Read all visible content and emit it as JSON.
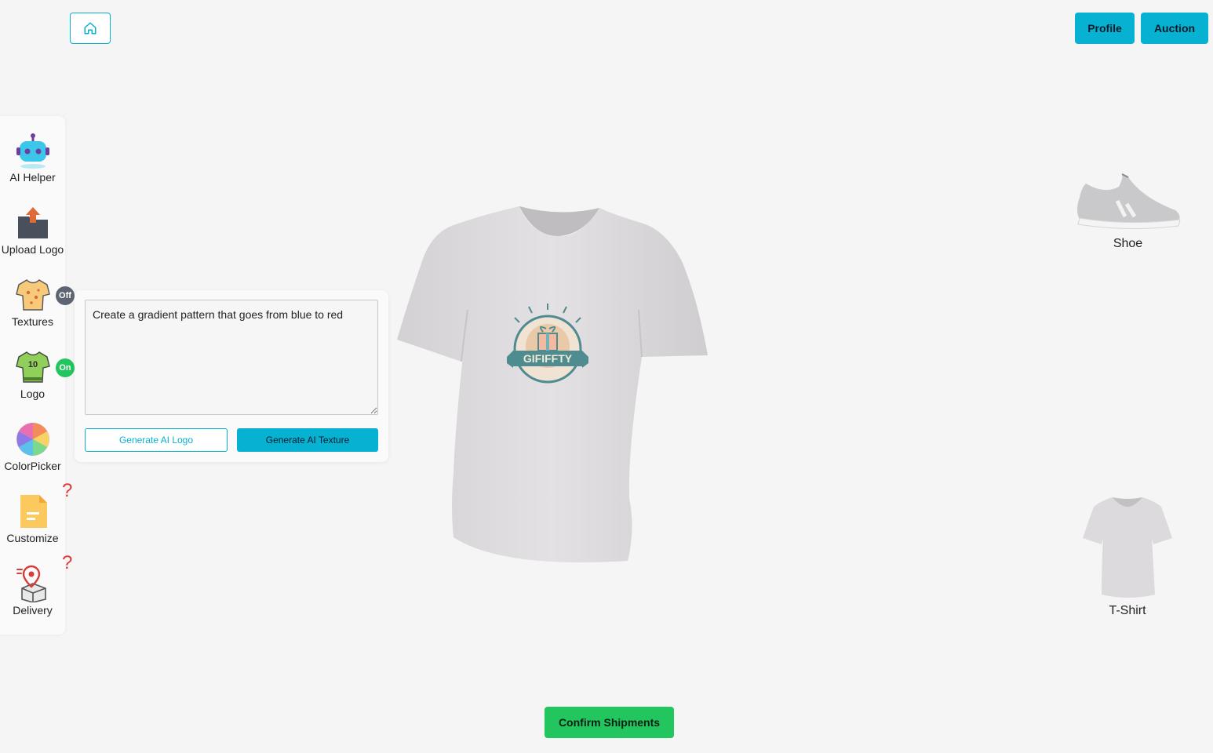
{
  "header": {
    "home_icon": "home-icon",
    "profile_label": "Profile",
    "auction_label": "Auction"
  },
  "sidebar": {
    "items": [
      {
        "label": "AI Helper",
        "icon": "robot-icon"
      },
      {
        "label": "Upload Logo",
        "icon": "upload-folder-icon"
      },
      {
        "label": "Textures",
        "icon": "shirt-texture-icon",
        "badge": "Off"
      },
      {
        "label": "Logo",
        "icon": "jersey-logo-icon",
        "badge": "On"
      },
      {
        "label": "ColorPicker",
        "icon": "color-wheel-icon"
      },
      {
        "label": "Customize",
        "icon": "document-icon",
        "hint": "?"
      },
      {
        "label": "Delivery",
        "icon": "delivery-box-icon",
        "hint": "?"
      }
    ]
  },
  "ai_panel": {
    "prompt_value": "Create a gradient pattern that goes from blue to red",
    "generate_logo_label": "Generate AI Logo",
    "generate_texture_label": "Generate AI Texture"
  },
  "model": {
    "logo_text": "GIFIFFTY"
  },
  "products": [
    {
      "label": "Shoe",
      "icon": "shoe-icon"
    },
    {
      "label": "T-Shirt",
      "icon": "tshirt-icon"
    }
  ],
  "footer": {
    "confirm_label": "Confirm Shipments"
  },
  "colors": {
    "accent": "#06b1d1",
    "success": "#22c55e",
    "badge_off": "#5e6572",
    "hint": "#e03b3b",
    "background": "#f5f5f5"
  }
}
